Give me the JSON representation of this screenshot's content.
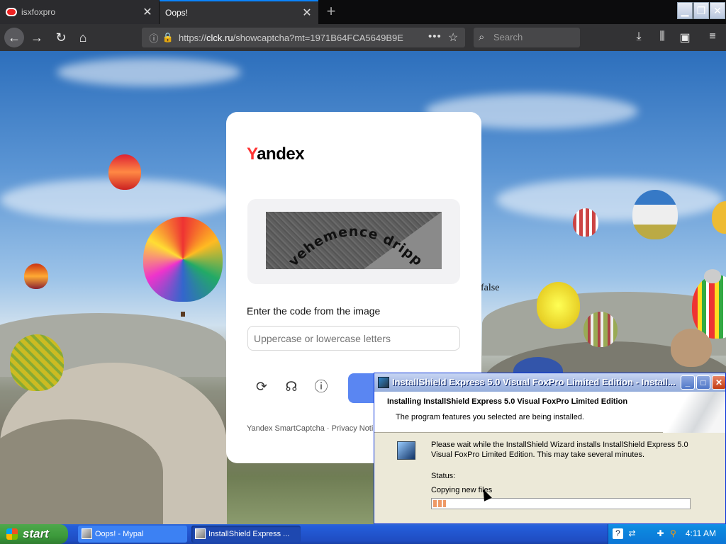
{
  "browser": {
    "tabs": [
      {
        "title": "isxfoxpro",
        "active": false
      },
      {
        "title": "Oops!",
        "active": true
      }
    ],
    "url_prefix": "https://",
    "url_host": "clck.ru",
    "url_path": "/showcaptcha?mt=1971B64FCA5649B9E",
    "search_placeholder": "Search",
    "icons": {
      "back": "back-arrow-icon",
      "forward": "forward-arrow-icon",
      "reload": "reload-icon",
      "home": "home-icon",
      "info": "info-icon",
      "lock": "lock-icon",
      "menu_dots": "more-dots-icon",
      "bookmark": "star-icon",
      "download": "download-icon",
      "library": "library-icon",
      "sidebar": "sidebar-icon",
      "hamburger": "hamburger-menu-icon"
    }
  },
  "page": {
    "stray_text": "false",
    "captcha": {
      "logo_first": "Y",
      "logo_rest": "andex",
      "image_text": "vehemence dripping",
      "label": "Enter the code from the image",
      "input_placeholder": "Uppercase or lowercase letters",
      "footer": "Yandex SmartCaptcha · Privacy Noti",
      "accent_color": "#5a86f2"
    }
  },
  "installer": {
    "title": "InstallShield Express 5.0 Visual FoxPro Limited Edition - Install...",
    "heading": "Installing InstallShield Express 5.0 Visual FoxPro Limited Edition",
    "subheading": "The program features you selected are being installed.",
    "message": "Please wait while the InstallShield Wizard installs InstallShield Express 5.0 Visual FoxPro Limited Edition. This may take several minutes.",
    "status_label": "Status:",
    "status_text": "Copying new files",
    "progress": 0.05
  },
  "taskbar": {
    "start_label": "start",
    "items": [
      {
        "label": "Oops! - Mypal"
      },
      {
        "label": "InstallShield Express ..."
      }
    ],
    "clock": "4:11 AM"
  }
}
